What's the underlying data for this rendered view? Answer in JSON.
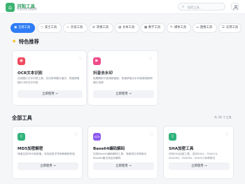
{
  "header": {
    "logo_glyph": "⌂",
    "brand_name": "河狗工具",
    "brand_subtitle": "专注在线工具服务",
    "search_placeholder": "搜索工具...",
    "search_icon": "search-icon",
    "user_icon": "user-icon"
  },
  "tabs": [
    {
      "icon": "▣",
      "label": "全部工具",
      "active": true
    },
    {
      "icon": "◌",
      "label": "安全工具",
      "active": false
    },
    {
      "icon": "‹›",
      "label": "开发工具",
      "active": false
    },
    {
      "icon": "⇄",
      "label": "转换工具",
      "active": false
    },
    {
      "icon": "▤",
      "label": "文本工具",
      "active": false
    },
    {
      "icon": "▦",
      "label": "数字工具",
      "active": false
    },
    {
      "icon": "✎",
      "label": "媒体工具",
      "active": false
    },
    {
      "icon": "▭",
      "label": "图像工具",
      "active": false
    },
    {
      "icon": "☰",
      "label": "实用工具",
      "active": false
    }
  ],
  "featured": {
    "title": "特色推荐",
    "cards": [
      {
        "icon_glyph": "◉",
        "icon_color": "#f04a5e",
        "title": "OCR文本识别",
        "description": "在线图片文字识别工具，支持多种图片格式，快速提取图片中的文字内容",
        "button": "立即使用 →"
      },
      {
        "icon_glyph": "▶",
        "icon_color": "#f04a8a",
        "title": "抖音去水印",
        "description": "免费解析抖音视频链接，快速获取无水印高清视频和图片资源",
        "button": "立即使用 →"
      }
    ]
  },
  "all_tools": {
    "title": "全部工具",
    "count": "共 28 个工具",
    "cards": [
      {
        "icon_glyph": "◊",
        "icon_color": "#2fb27a",
        "title": "MD5加密解密",
        "description": "快速生成MD5哈希值，支持加密字符串和解密校验",
        "button": "立即使用 →"
      },
      {
        "icon_glyph": "</>",
        "icon_color": "#8c5cf0",
        "title": "Base64编码解码",
        "description": "在线Base64编码解码工具，快速将文本转换为Base64格式或反向解码",
        "button": "立即使用 →"
      },
      {
        "icon_glyph": "◊",
        "icon_color": "#2fb27a",
        "title": "SHA加密工具",
        "description": "在线SHA加密工具，支持SHA1、SHA224、SHA256、SHA384、SHA512多种算法",
        "button": "立即使用 →"
      }
    ]
  },
  "colors": {
    "accent": "#2f7cf6",
    "brand_green": "#2f9e5f",
    "star": "#f5b800"
  }
}
